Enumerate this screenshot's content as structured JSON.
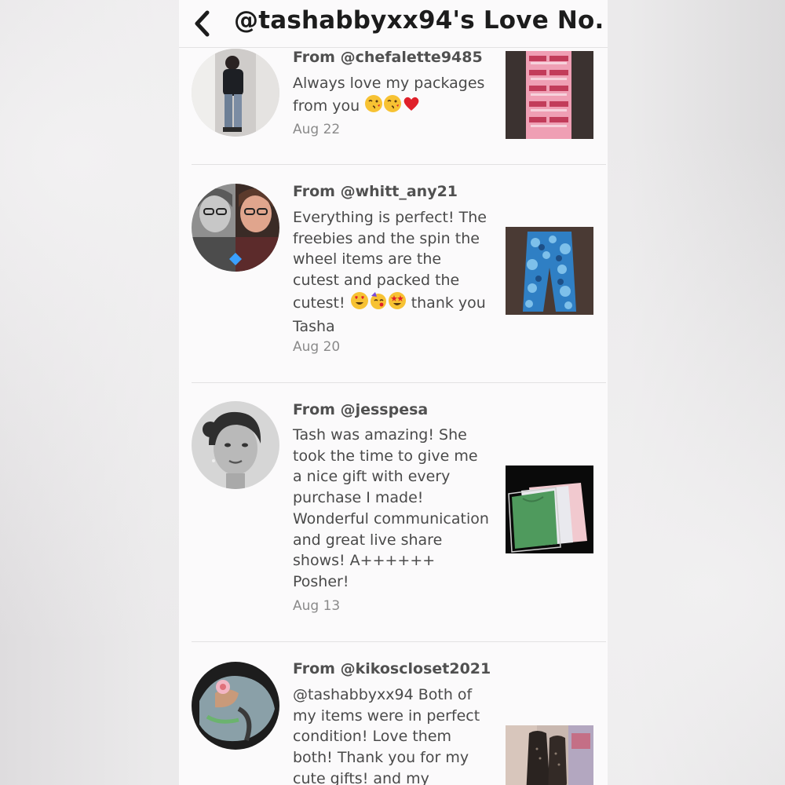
{
  "header": {
    "title": "@tashabbyxx94's Love No..."
  },
  "notes": [
    {
      "from": "From @chefalette9485",
      "message": "Always love my packages from you",
      "date": "Aug 22",
      "thumb_label": "FRAGILE"
    },
    {
      "from": "From @whitt_any21",
      "message": "Everything is perfect! The freebies and the spin the wheel items are the cutest and packed the cutest!",
      "message_tail": "thank you Tasha",
      "date": "Aug 20"
    },
    {
      "from": "From @jesspesa",
      "message": "Tash was amazing! She took the time to give me a nice gift with every purchase I made! Wonderful communication and great live share shows! A++++++ Posher!",
      "date": "Aug 13"
    },
    {
      "from": "From @kikoscloset2021",
      "message": "@tashabbyxx94 Both of my items were in perfect condition! Love them both! Thank you for my cute gifts! and my"
    }
  ],
  "colors": {
    "heart": "#e0202a",
    "emoji_face": "#f7c233"
  }
}
